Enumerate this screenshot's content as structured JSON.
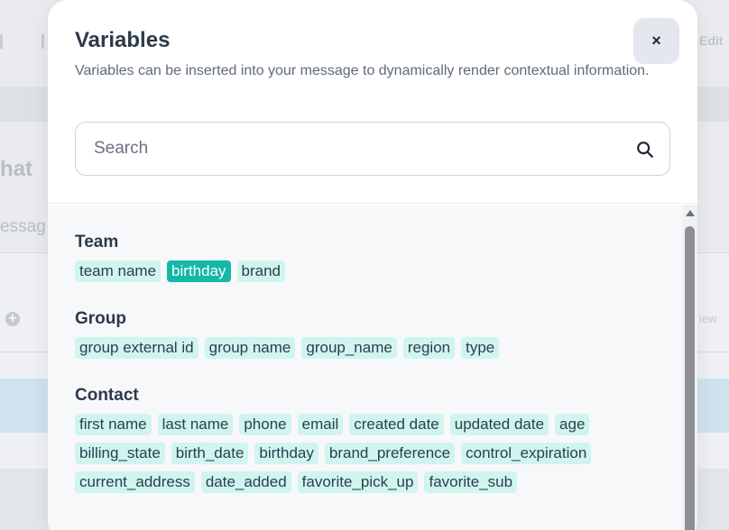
{
  "background": {
    "heading": "hat",
    "subheading": "essag",
    "edit_label": "Edit",
    "view_label": "iew"
  },
  "modal": {
    "title": "Variables",
    "description": "Variables can be inserted into your message to dynamically render contextual information.",
    "close_label": "×",
    "search": {
      "placeholder": "Search",
      "value": ""
    },
    "sections": {
      "team": {
        "title": "Team",
        "tags": [
          "team name",
          "birthday",
          "brand"
        ],
        "active_tag": "birthday"
      },
      "group": {
        "title": "Group",
        "tags": [
          "group external id",
          "group name",
          "group_name",
          "region",
          "type"
        ]
      },
      "contact": {
        "title": "Contact",
        "tags": [
          "first name",
          "last name",
          "phone",
          "email",
          "created date",
          "updated date",
          "age",
          "billing_state",
          "birth_date",
          "birthday",
          "brand_preference",
          "control_expiration",
          "current_address",
          "date_added",
          "favorite_pick_up",
          "favorite_sub"
        ]
      }
    }
  },
  "colors": {
    "accent": "#14b8a6",
    "tag_bg": "#d0f5ee",
    "title": "#2d3a4a"
  }
}
